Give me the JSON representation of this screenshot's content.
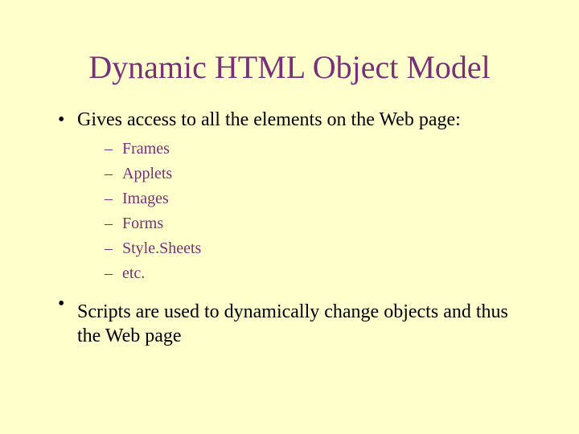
{
  "title": "Dynamic HTML Object Model",
  "bullets": {
    "b1": "Gives access to all the elements on the Web page:",
    "sub": {
      "s1": "Frames",
      "s2": "Applets",
      "s3": "Images",
      "s4": "Forms",
      "s5": "Style.Sheets",
      "s6": "etc."
    },
    "b2": "Scripts are used to dynamically change objects and thus the Web page"
  }
}
